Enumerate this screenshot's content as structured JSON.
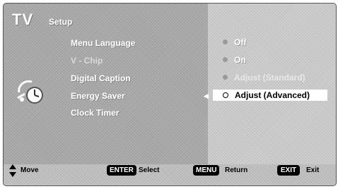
{
  "header": {
    "title": "TV",
    "subtitle": "Setup"
  },
  "menu": {
    "items": [
      {
        "label": "Menu Language",
        "state": "enabled"
      },
      {
        "label": "V - Chip",
        "state": "dimmed"
      },
      {
        "label": "Digital Caption",
        "state": "enabled"
      },
      {
        "label": "Energy Saver",
        "state": "active"
      },
      {
        "label": "Clock Timer",
        "state": "enabled"
      }
    ]
  },
  "options": {
    "items": [
      {
        "label": "Off"
      },
      {
        "label": "On"
      },
      {
        "label": "Adjust (Standard)"
      },
      {
        "label": "Adjust (Advanced)",
        "selected": true
      }
    ]
  },
  "footer": {
    "move_label": "Move",
    "enter_key": "ENTER",
    "select_label": "Select",
    "menu_key": "MENU",
    "return_label": "Return",
    "exit_key": "EXIT",
    "exit_label": "Exit"
  },
  "icons": {
    "section_icon": "clock-icon",
    "navigation_icon": "up-down-arrow-icon"
  },
  "colors": {
    "background": "#a9a9a9",
    "panel": "#c9c9c9",
    "highlight": "#ffffff",
    "key_background": "#000000"
  }
}
